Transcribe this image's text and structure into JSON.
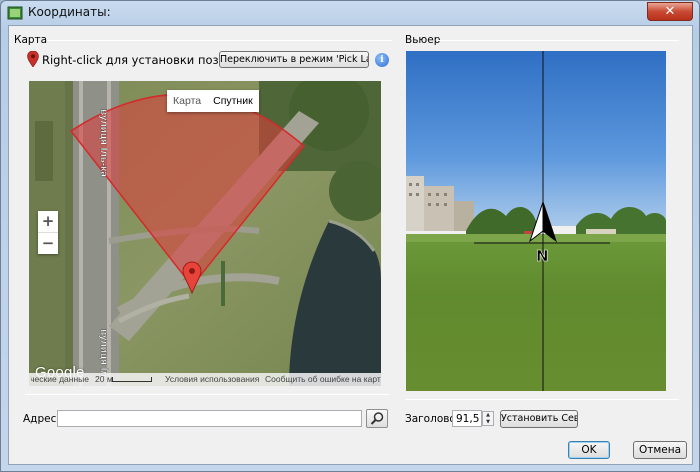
{
  "window": {
    "title": "Координаты:",
    "close_glyph": "✕"
  },
  "map_panel": {
    "group_label": "Карта",
    "hint": "Right-click для установки позиции!",
    "pick_landmark_button": "Переключить в режим 'Pick Landmark'",
    "info_glyph": "i",
    "map": {
      "type_options": [
        "Карта",
        "Спутник"
      ],
      "zoom_in": "+",
      "zoom_out": "−",
      "logo": "Google",
      "street_labels": [
        "вулиця Іль-ка",
        "вулиця Іль-"
      ],
      "footer": {
        "data_credit": "Картографические данные",
        "scale": "20 м",
        "terms": "Условия использования",
        "report": "Сообщить об ошибке на карте"
      }
    },
    "address_label": "Адрес:",
    "address_value": "",
    "search_icon": "magnifier-icon"
  },
  "viewer_panel": {
    "group_label": "Вьюер",
    "compass_label": "N",
    "heading_label": "Заголовок:",
    "heading_value": "91,5",
    "set_north_button": "Установить Север"
  },
  "footer": {
    "ok_button": "OK",
    "cancel_button": "Отмена"
  },
  "colors": {
    "accent_pin": "#c8302a",
    "view_cone": "#e03a3a"
  }
}
